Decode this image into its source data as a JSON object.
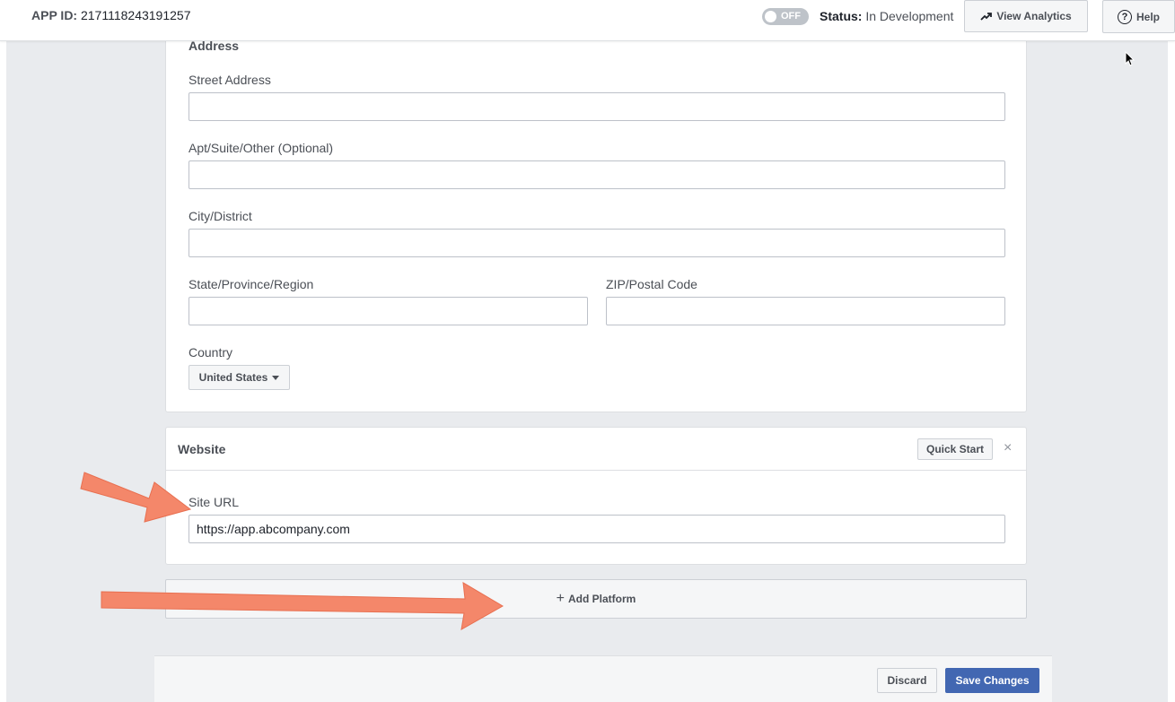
{
  "header": {
    "app_id_label": "APP ID:",
    "app_id_value": "2171118243191257",
    "toggle_label": "OFF",
    "status_label": "Status:",
    "status_value": "In Development",
    "view_analytics_label": "View Analytics",
    "help_label": "Help",
    "help_glyph": "?"
  },
  "address": {
    "section_title": "Address",
    "street_label": "Street Address",
    "street_value": "",
    "apt_label": "Apt/Suite/Other (Optional)",
    "apt_value": "",
    "city_label": "City/District",
    "city_value": "",
    "state_label": "State/Province/Region",
    "state_value": "",
    "zip_label": "ZIP/Postal Code",
    "zip_value": "",
    "country_label": "Country",
    "country_selected": "United States"
  },
  "website": {
    "title": "Website",
    "quick_start_label": "Quick Start",
    "close_glyph": "×",
    "site_url_label": "Site URL",
    "site_url_value": "https://app.abcompany.com"
  },
  "add_platform": {
    "plus_glyph": "+",
    "label": "Add Platform"
  },
  "footer": {
    "discard_label": "Discard",
    "save_label": "Save Changes"
  },
  "colors": {
    "accent": "#4267b2",
    "annotation_arrow": "#f4876a",
    "background": "#e9ebee"
  },
  "icons": {
    "analytics": "trending-up-icon",
    "help": "question-circle-icon",
    "dropdown": "caret-down-icon",
    "close": "close-icon",
    "add": "plus-icon"
  }
}
